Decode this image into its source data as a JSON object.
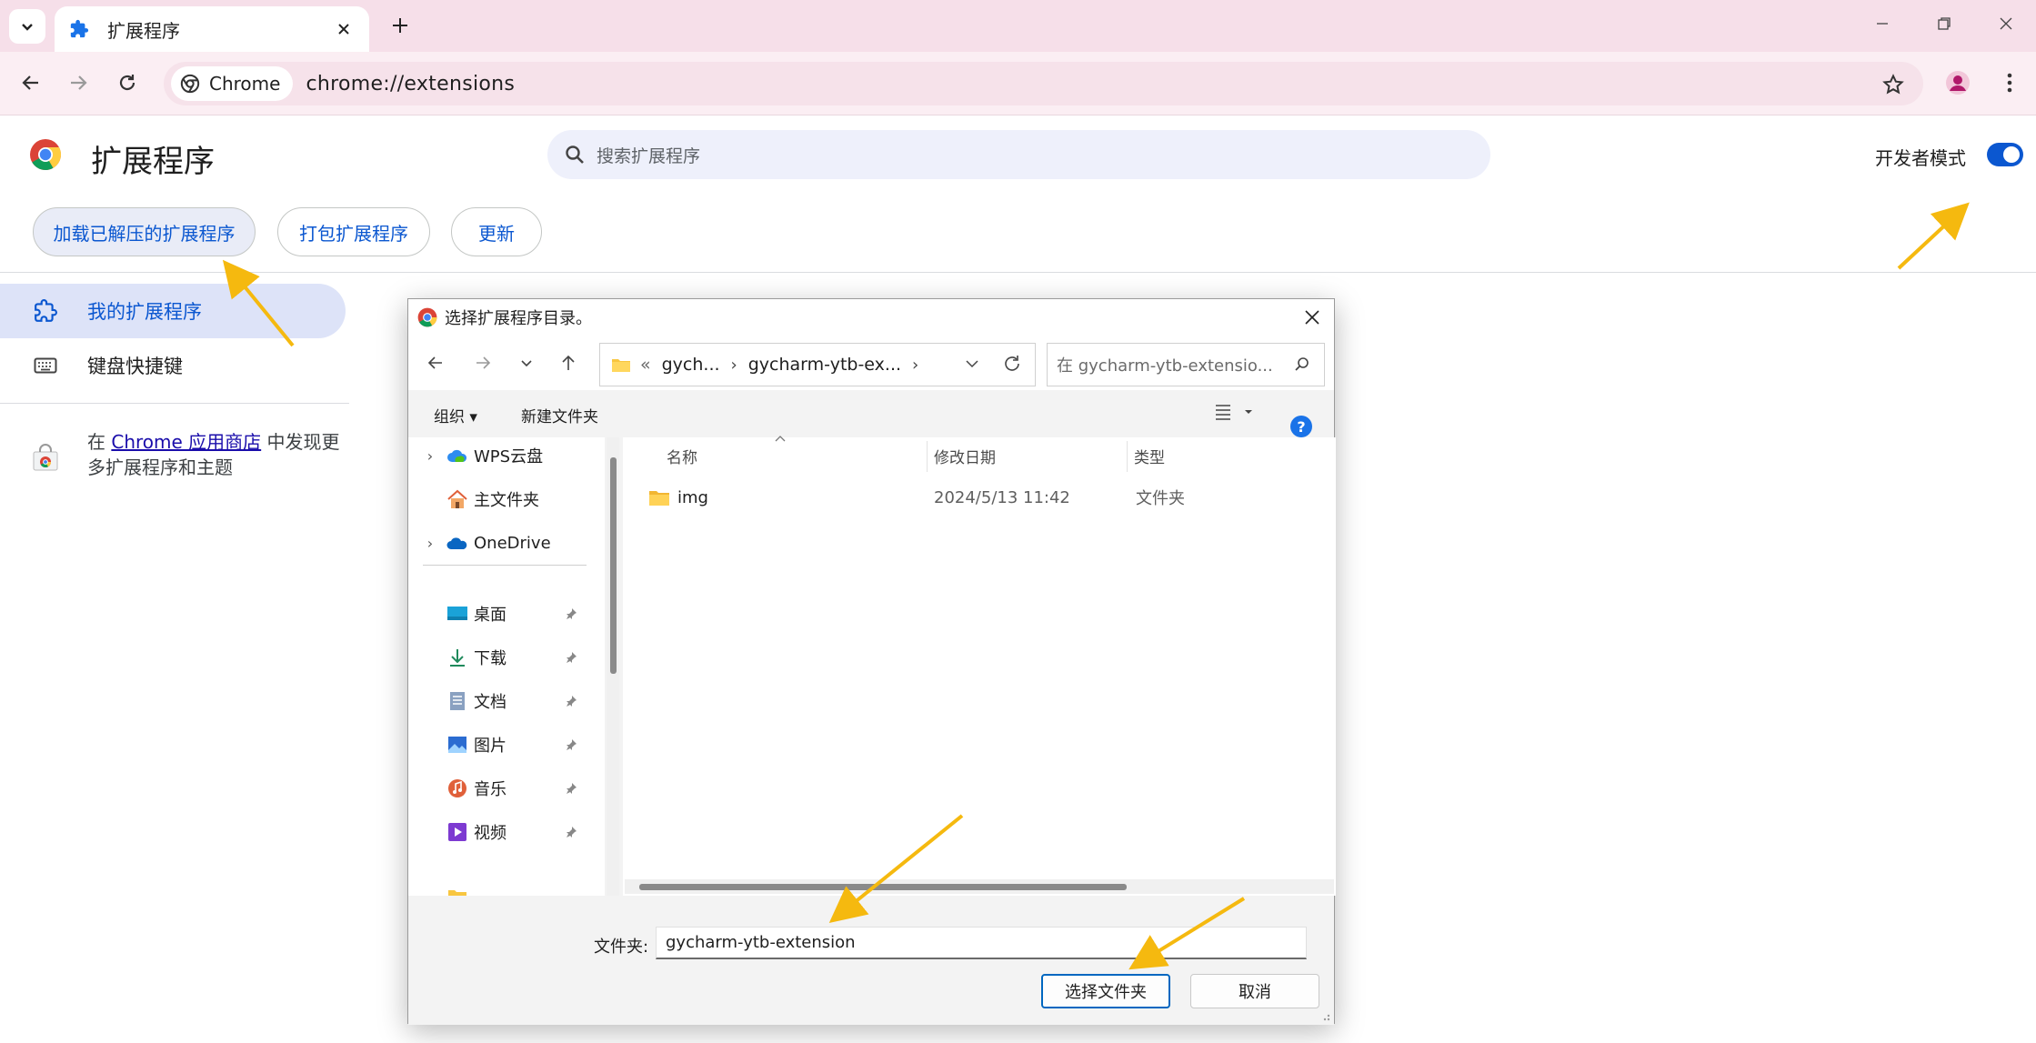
{
  "browser": {
    "tab_title": "扩展程序",
    "omnibox_chip": "Chrome",
    "url": "chrome://extensions"
  },
  "page": {
    "title": "扩展程序",
    "search_placeholder": "搜索扩展程序",
    "dev_mode_label": "开发者模式",
    "dev_mode_on": true,
    "buttons": {
      "load_unpacked": "加载已解压的扩展程序",
      "pack": "打包扩展程序",
      "update": "更新"
    },
    "sidebar": {
      "items": [
        {
          "label": "我的扩展程序",
          "icon": "puzzle-icon",
          "selected": true
        },
        {
          "label": "键盘快捷键",
          "icon": "keyboard-icon",
          "selected": false
        }
      ],
      "store_prefix": "在 ",
      "store_link": "Chrome 应用商店",
      "store_suffix": " 中发现更多扩展程序和主题"
    }
  },
  "dialog": {
    "title": "选择扩展程序目录。",
    "breadcrumb": [
      "«",
      "gych...",
      "gycharm-ytb-ex..."
    ],
    "search_placeholder": "在 gycharm-ytb-extensio...",
    "commands": {
      "organize": "组织 ▾",
      "new_folder": "新建文件夹"
    },
    "tree": [
      {
        "label": "WPS云盘",
        "icon": "cloud-icon",
        "expandable": true
      },
      {
        "label": "主文件夹",
        "icon": "home-icon",
        "expandable": false
      },
      {
        "label": "OneDrive",
        "icon": "onedrive-icon",
        "expandable": true
      },
      {
        "label": "桌面",
        "icon": "desktop-icon",
        "pinned": true
      },
      {
        "label": "下载",
        "icon": "download-icon",
        "pinned": true
      },
      {
        "label": "文档",
        "icon": "document-icon",
        "pinned": true
      },
      {
        "label": "图片",
        "icon": "pictures-icon",
        "pinned": true
      },
      {
        "label": "音乐",
        "icon": "music-icon",
        "pinned": true
      },
      {
        "label": "视频",
        "icon": "video-icon",
        "pinned": true
      }
    ],
    "columns": {
      "name": "名称",
      "modified": "修改日期",
      "type": "类型"
    },
    "files": [
      {
        "name": "img",
        "modified": "2024/5/13 11:42",
        "type": "文件夹"
      }
    ],
    "folder_label": "文件夹:",
    "folder_value": "gycharm-ytb-extension",
    "select_button": "选择文件夹",
    "cancel_button": "取消"
  },
  "colors": {
    "accent": "#0b57d0",
    "arrow": "#f5b90f",
    "tabstrip": "#f6dfe9"
  }
}
